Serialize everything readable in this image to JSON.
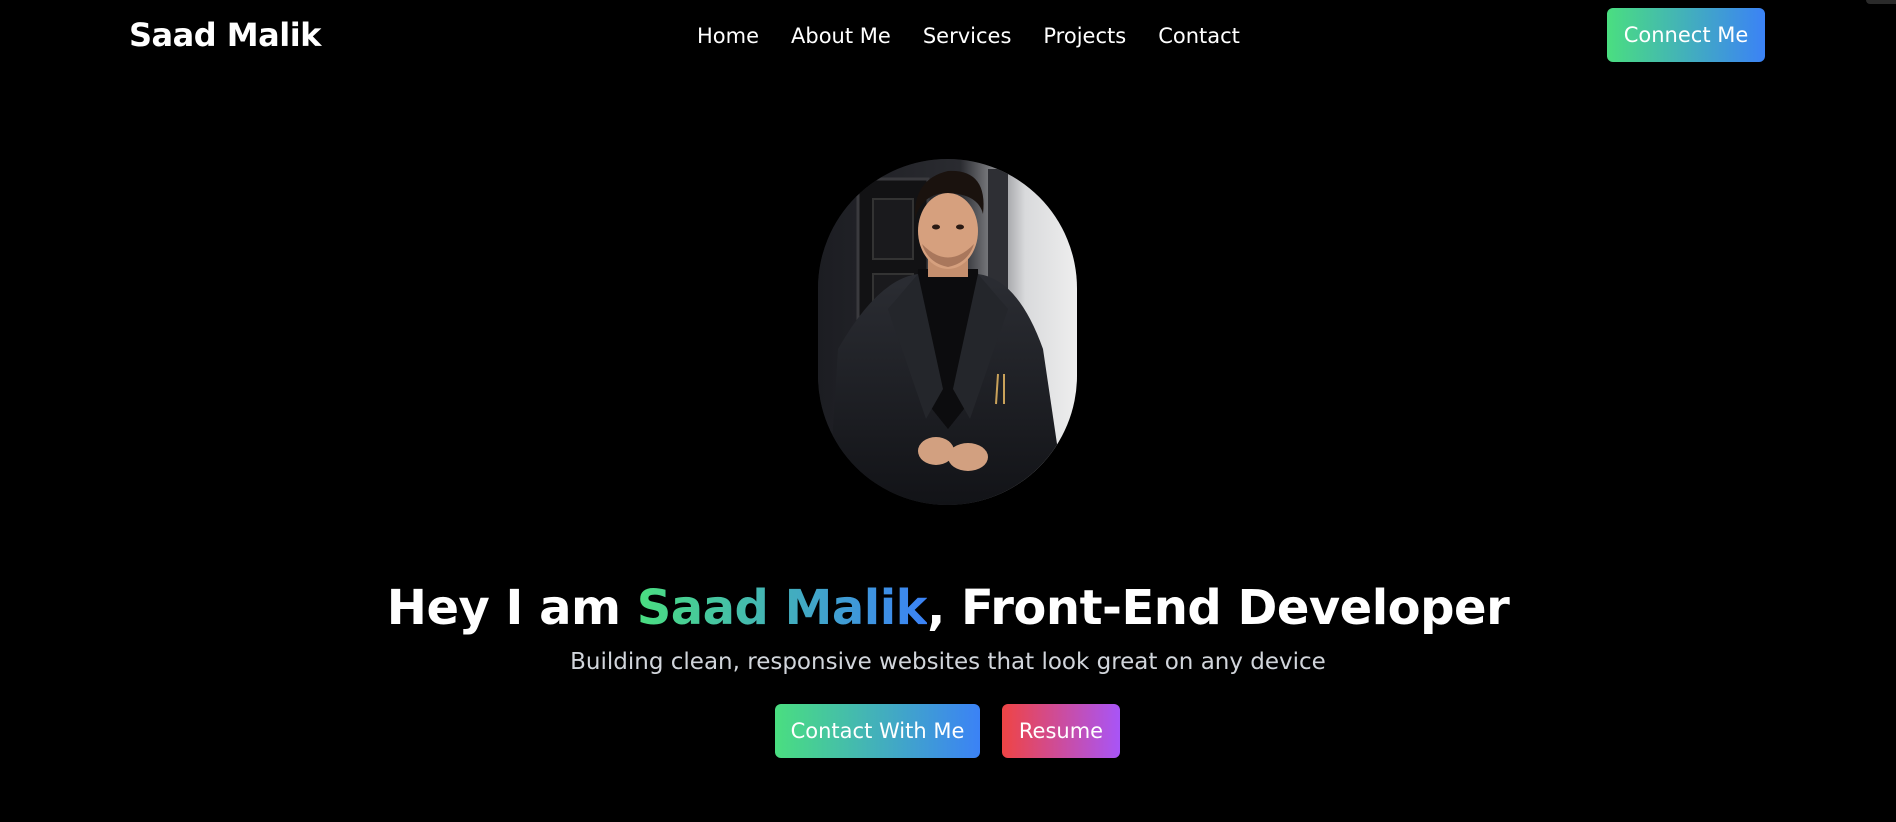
{
  "brand": {
    "name": "Saad Malik"
  },
  "nav": {
    "items": [
      {
        "label": "Home"
      },
      {
        "label": "About Me"
      },
      {
        "label": "Services"
      },
      {
        "label": "Projects"
      },
      {
        "label": "Contact"
      }
    ],
    "connect_label": "Connect Me"
  },
  "hero": {
    "heading_prefix": "Hey I am ",
    "heading_name": "Saad Malik",
    "heading_suffix": ", Front-End Developer",
    "subtitle": "Building clean, responsive websites that look great on any device",
    "contact_label": "Contact With Me",
    "resume_label": "Resume"
  },
  "colors": {
    "background": "#000000",
    "accent_gradient_start": "#4ade80",
    "accent_gradient_end": "#3b82f6",
    "resume_gradient_start": "#ef4444",
    "resume_gradient_end": "#a855f7",
    "subtitle_text": "#d1d5db"
  }
}
